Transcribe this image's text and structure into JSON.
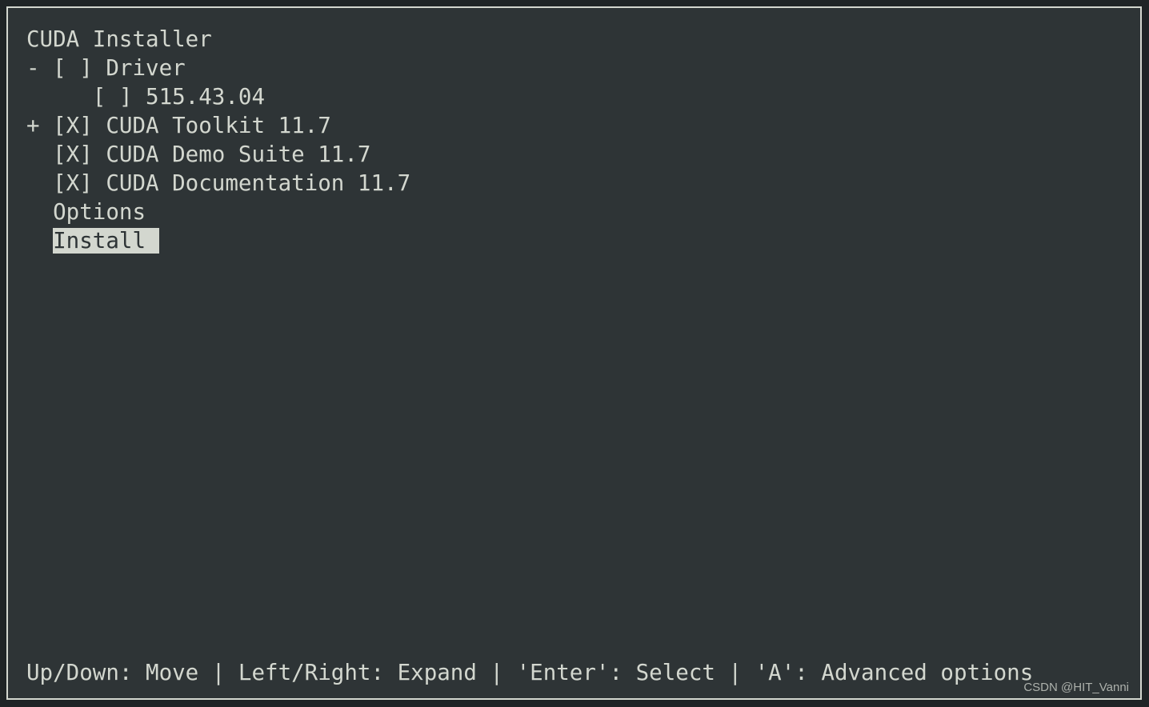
{
  "window": {
    "name": "cuda-installer-tui",
    "background_color": "#2e3436",
    "border_color": "#d3d7cf",
    "text_color": "#d3d7cf",
    "highlight_background": "#d3d7cf",
    "highlight_text_color": "#2e3436"
  },
  "header": {
    "title": "CUDA Installer"
  },
  "menu": {
    "items": [
      {
        "expander": "-",
        "checkbox": "[ ]",
        "label": "Driver",
        "text": "- [ ] Driver",
        "selected": false,
        "checked": false,
        "expanded": true,
        "indent": 0
      },
      {
        "expander": " ",
        "checkbox": "[ ]",
        "label": "515.43.04",
        "text": "     [ ] 515.43.04",
        "selected": false,
        "checked": false,
        "indent": 5
      },
      {
        "expander": "+",
        "checkbox": "[X]",
        "label": "CUDA Toolkit 11.7",
        "text": "+ [X] CUDA Toolkit 11.7",
        "selected": false,
        "checked": true,
        "expanded": false,
        "indent": 0
      },
      {
        "expander": " ",
        "checkbox": "[X]",
        "label": "CUDA Demo Suite 11.7",
        "text": "  [X] CUDA Demo Suite 11.7",
        "selected": false,
        "checked": true,
        "indent": 2
      },
      {
        "expander": " ",
        "checkbox": "[X]",
        "label": "CUDA Documentation 11.7",
        "text": "  [X] CUDA Documentation 11.7",
        "selected": false,
        "checked": true,
        "indent": 2
      },
      {
        "expander": " ",
        "checkbox": "",
        "label": "Options",
        "text": "  Options",
        "selected": false,
        "indent": 2
      },
      {
        "expander": " ",
        "checkbox": "",
        "label": "Install",
        "text": "  Install",
        "selected": true,
        "indent": 2,
        "prefix": "  ",
        "highlight_text": "Install "
      }
    ]
  },
  "status_bar": {
    "text": "Up/Down: Move | Left/Right: Expand | 'Enter': Select | 'A': Advanced options",
    "hints": [
      {
        "keys": "Up/Down",
        "action": "Move"
      },
      {
        "keys": "Left/Right",
        "action": "Expand"
      },
      {
        "keys": "'Enter'",
        "action": "Select"
      },
      {
        "keys": "'A'",
        "action": "Advanced options"
      }
    ],
    "separator": "|"
  },
  "watermark": {
    "text": "CSDN @HIT_Vanni"
  }
}
